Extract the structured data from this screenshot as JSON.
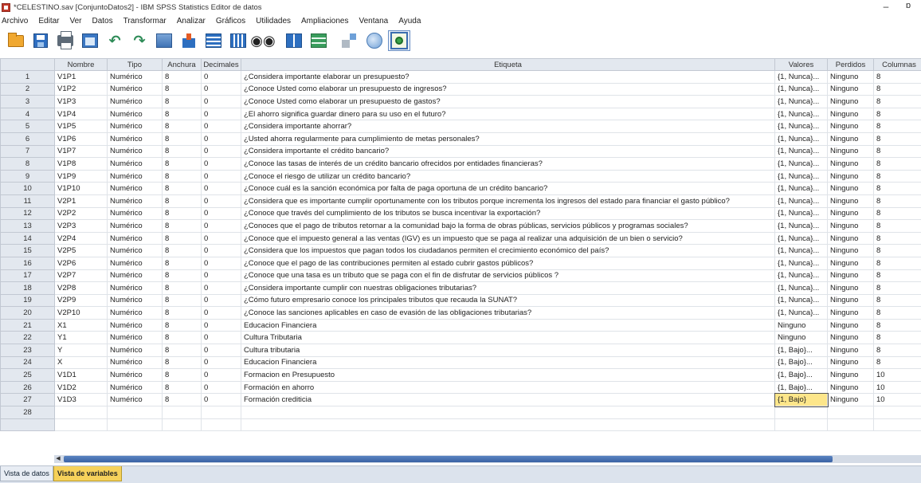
{
  "window": {
    "title": "*CELESTINO.sav [ConjuntoDatos2] - IBM SPSS Statistics Editor de datos",
    "minimize_glyph": "–",
    "maximize_glyph": "ɒ"
  },
  "menu": [
    "Archivo",
    "Editar",
    "Ver",
    "Datos",
    "Transformar",
    "Analizar",
    "Gráficos",
    "Utilidades",
    "Ampliaciones",
    "Ventana",
    "Ayuda"
  ],
  "toolbar_icons": [
    "open-folder-icon",
    "save-icon",
    "print-icon",
    "dialog-recall-icon",
    "undo-icon",
    "redo-icon",
    "go-to-case-icon",
    "variables-icon",
    "insert-cases-icon",
    "insert-variable-icon",
    "find-icon",
    "split-file-icon",
    "weight-cases-icon",
    "select-cases-icon",
    "value-labels-icon",
    "use-variable-sets-icon"
  ],
  "grid": {
    "columns": [
      "Nombre",
      "Tipo",
      "Anchura",
      "Decimales",
      "Etiqueta",
      "Valores",
      "Perdidos",
      "Columnas"
    ],
    "rows": [
      [
        "1",
        "V1P1",
        "Numérico",
        "8",
        "0",
        "¿Considera importante elaborar un presupuesto?",
        "{1, Nunca}...",
        "Ninguno",
        "8"
      ],
      [
        "2",
        "V1P2",
        "Numérico",
        "8",
        "0",
        "¿Conoce Usted como elaborar un presupuesto de ingresos?",
        "{1, Nunca}...",
        "Ninguno",
        "8"
      ],
      [
        "3",
        "V1P3",
        "Numérico",
        "8",
        "0",
        "¿Conoce Usted como elaborar un presupuesto de gastos?",
        "{1, Nunca}...",
        "Ninguno",
        "8"
      ],
      [
        "4",
        "V1P4",
        "Numérico",
        "8",
        "0",
        "¿El ahorro significa guardar dinero para su uso en el futuro?",
        "{1, Nunca}...",
        "Ninguno",
        "8"
      ],
      [
        "5",
        "V1P5",
        "Numérico",
        "8",
        "0",
        "¿Considera importante ahorrar?",
        "{1, Nunca}...",
        "Ninguno",
        "8"
      ],
      [
        "6",
        "V1P6",
        "Numérico",
        "8",
        "0",
        "¿Usted ahorra regularmente para cumplimiento de metas personales?",
        "{1, Nunca}...",
        "Ninguno",
        "8"
      ],
      [
        "7",
        "V1P7",
        "Numérico",
        "8",
        "0",
        "¿Considera importante el crédito bancario?",
        "{1, Nunca}...",
        "Ninguno",
        "8"
      ],
      [
        "8",
        "V1P8",
        "Numérico",
        "8",
        "0",
        "¿Conoce las tasas de interés de un crédito bancario ofrecidos por entidades financieras?",
        "{1, Nunca}...",
        "Ninguno",
        "8"
      ],
      [
        "9",
        "V1P9",
        "Numérico",
        "8",
        "0",
        "¿Conoce el riesgo de utilizar un crédito bancario?",
        "{1, Nunca}...",
        "Ninguno",
        "8"
      ],
      [
        "10",
        "V1P10",
        "Numérico",
        "8",
        "0",
        "¿Conoce cuál es la sanción económica por falta de paga oportuna de un crédito bancario?",
        "{1, Nunca}...",
        "Ninguno",
        "8"
      ],
      [
        "11",
        "V2P1",
        "Numérico",
        "8",
        "0",
        "¿Considera que es importante cumplir oportunamente con los tributos porque incrementa los ingresos del estado para financiar el gasto público?",
        "{1, Nunca}...",
        "Ninguno",
        "8"
      ],
      [
        "12",
        "V2P2",
        "Numérico",
        "8",
        "0",
        "¿Conoce que través del cumplimiento de los tributos se busca incentivar la exportación?",
        "{1, Nunca}...",
        "Ninguno",
        "8"
      ],
      [
        "13",
        "V2P3",
        "Numérico",
        "8",
        "0",
        "¿Conoces que el pago de tributos retornar a la comunidad bajo la forma de obras públicas, servicios públicos y programas sociales?",
        "{1, Nunca}...",
        "Ninguno",
        "8"
      ],
      [
        "14",
        "V2P4",
        "Numérico",
        "8",
        "0",
        "¿Conoce que el impuesto general a las ventas (IGV) es un impuesto que se paga al realizar una adquisición de un bien o servicio?",
        "{1, Nunca}...",
        "Ninguno",
        "8"
      ],
      [
        "15",
        "V2P5",
        "Numérico",
        "8",
        "0",
        "¿Considera que los impuestos que pagan todos los ciudadanos permiten el crecimiento económico del país?",
        "{1, Nunca}...",
        "Ninguno",
        "8"
      ],
      [
        "16",
        "V2P6",
        "Numérico",
        "8",
        "0",
        "¿Conoce que el pago de las contribuciones permiten al estado cubrir gastos públicos?",
        "{1, Nunca}...",
        "Ninguno",
        "8"
      ],
      [
        "17",
        "V2P7",
        "Numérico",
        "8",
        "0",
        "¿Conoce que una tasa es un tributo que se paga con el fin de disfrutar de servicios públicos ?",
        "{1, Nunca}...",
        "Ninguno",
        "8"
      ],
      [
        "18",
        "V2P8",
        "Numérico",
        "8",
        "0",
        "¿Considera importante cumplir con nuestras obligaciones tributarias?",
        "{1, Nunca}...",
        "Ninguno",
        "8"
      ],
      [
        "19",
        "V2P9",
        "Numérico",
        "8",
        "0",
        "¿Cómo futuro empresario conoce los principales tributos que recauda la SUNAT?",
        "{1, Nunca}...",
        "Ninguno",
        "8"
      ],
      [
        "20",
        "V2P10",
        "Numérico",
        "8",
        "0",
        "¿Conoce las sanciones aplicables en caso de evasión de las obligaciones tributarias?",
        "{1, Nunca}...",
        "Ninguno",
        "8"
      ],
      [
        "21",
        "X1",
        "Numérico",
        "8",
        "0",
        "Educacion Financiera",
        "Ninguno",
        "Ninguno",
        "8"
      ],
      [
        "22",
        "Y1",
        "Numérico",
        "8",
        "0",
        "Cultura Tributaria",
        "Ninguno",
        "Ninguno",
        "8"
      ],
      [
        "23",
        "Y",
        "Numérico",
        "8",
        "0",
        "Cultura tributaria",
        "{1, Bajo}...",
        "Ninguno",
        "8"
      ],
      [
        "24",
        "X",
        "Numérico",
        "8",
        "0",
        "Educacion Financiera",
        "{1, Bajo}...",
        "Ninguno",
        "8"
      ],
      [
        "25",
        "V1D1",
        "Numérico",
        "8",
        "0",
        "Formacion en Presupuesto",
        "{1, Bajo}...",
        "Ninguno",
        "10"
      ],
      [
        "26",
        "V1D2",
        "Numérico",
        "8",
        "0",
        "Formación en ahorro",
        "{1, Bajo}...",
        "Ninguno",
        "10"
      ],
      [
        "27",
        "V1D3",
        "Numérico",
        "8",
        "0",
        "Formación crediticia",
        "{1, Bajo}",
        "Ninguno",
        "10"
      ],
      [
        "28",
        "",
        "",
        "",
        "",
        "",
        "",
        "",
        ""
      ],
      [
        "",
        "",
        "",
        "",
        "",
        "",
        "",
        "",
        ""
      ]
    ],
    "selected": {
      "row": 26,
      "col": 6
    }
  },
  "tabs": [
    {
      "label": "Vista de datos",
      "active": false
    },
    {
      "label": "Vista de variables",
      "active": true
    }
  ],
  "colors": {
    "header_bg": "#e3e8ef",
    "active_tab": "#f6d15b",
    "selected_cell": "#fde68a"
  }
}
